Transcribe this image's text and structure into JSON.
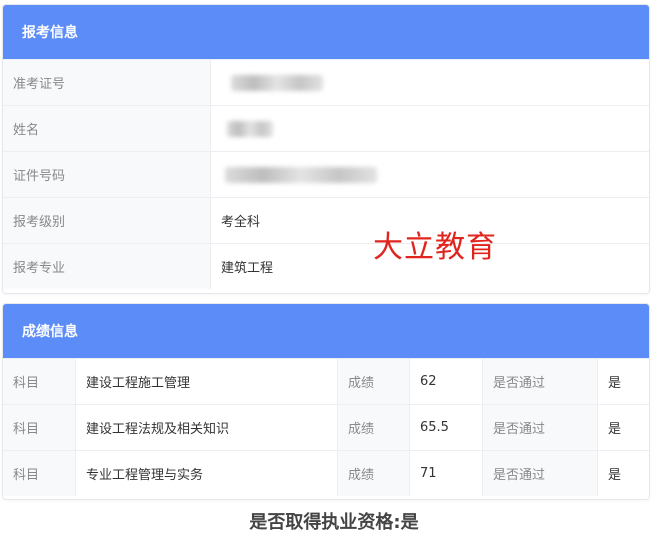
{
  "info_panel": {
    "title": "报考信息",
    "rows": [
      {
        "label": "准考证号",
        "value": ""
      },
      {
        "label": "姓名",
        "value": ""
      },
      {
        "label": "证件号码",
        "value": ""
      },
      {
        "label": "报考级别",
        "value": "考全科"
      },
      {
        "label": "报考专业",
        "value": "建筑工程"
      }
    ]
  },
  "watermark": "大立教育",
  "score_panel": {
    "title": "成绩信息",
    "subject_label": "科目",
    "score_label": "成绩",
    "pass_label": "是否通过",
    "rows": [
      {
        "subject": "建设工程施工管理",
        "score": "62",
        "passed": "是"
      },
      {
        "subject": "建设工程法规及相关知识",
        "score": "65.5",
        "passed": "是"
      },
      {
        "subject": "专业工程管理与实务",
        "score": "71",
        "passed": "是"
      }
    ]
  },
  "conclusion": "是否取得执业资格:是",
  "colors": {
    "header": "#5b8cf7",
    "watermark": "#e0241e"
  }
}
